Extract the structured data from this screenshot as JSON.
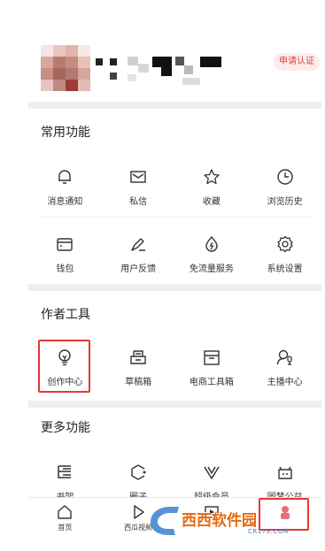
{
  "profile": {
    "apply_label": "申请认证"
  },
  "sections": [
    {
      "title": "常用功能",
      "rows": [
        [
          {
            "label": "消息通知",
            "icon": "bell-icon"
          },
          {
            "label": "私信",
            "icon": "message-icon"
          },
          {
            "label": "收藏",
            "icon": "star-icon"
          },
          {
            "label": "浏览历史",
            "icon": "clock-icon"
          }
        ],
        [
          {
            "label": "钱包",
            "icon": "wallet-icon"
          },
          {
            "label": "用户反馈",
            "icon": "feedback-icon"
          },
          {
            "label": "免流量服务",
            "icon": "data-saver-icon"
          },
          {
            "label": "系统设置",
            "icon": "gear-icon"
          }
        ]
      ]
    },
    {
      "title": "作者工具",
      "rows": [
        [
          {
            "label": "创作中心",
            "icon": "lightbulb-icon"
          },
          {
            "label": "草稿箱",
            "icon": "drafts-icon"
          },
          {
            "label": "电商工具箱",
            "icon": "toolbox-icon"
          },
          {
            "label": "主播中心",
            "icon": "streamer-icon"
          }
        ]
      ]
    },
    {
      "title": "更多功能",
      "rows": [
        [
          {
            "label": "书架",
            "icon": "bookshelf-icon"
          },
          {
            "label": "圈子",
            "icon": "circle-icon"
          },
          {
            "label": "超级会员",
            "icon": "vip-icon"
          },
          {
            "label": "圆梦公益",
            "icon": "charity-icon"
          }
        ]
      ]
    }
  ],
  "tabbar": [
    {
      "label": "首页",
      "icon": "home-icon"
    },
    {
      "label": "西瓜视频",
      "icon": "play-icon"
    },
    {
      "label": "",
      "icon": "video-icon"
    },
    {
      "label": "",
      "icon": "profile-icon"
    }
  ],
  "watermark": {
    "text": "西西软件园",
    "sub": "CR173.COM"
  },
  "colors": {
    "accent": "#e53935",
    "badge_bg": "#fdecec",
    "divider": "#efefef"
  }
}
